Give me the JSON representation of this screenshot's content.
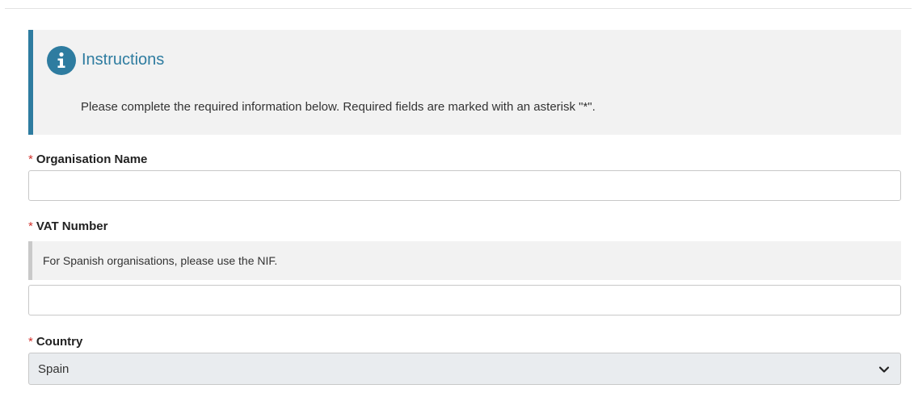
{
  "instructions": {
    "icon": "info-icon",
    "title": "Instructions",
    "text": "Please complete the required information below. Required fields are marked with an asterisk \"*\"."
  },
  "fields": {
    "organisation_name": {
      "required_marker": "*",
      "label": "Organisation Name",
      "value": ""
    },
    "vat_number": {
      "required_marker": "*",
      "label": "VAT Number",
      "help": "For Spanish organisations, please use the NIF.",
      "value": ""
    },
    "country": {
      "required_marker": "*",
      "label": "Country",
      "selected": "Spain",
      "icon": "chevron-down-icon"
    }
  },
  "colors": {
    "accent": "#2e7ca0",
    "required": "#d2322d",
    "panel_bg": "#f2f2f2",
    "select_bg": "#e9ecef"
  }
}
